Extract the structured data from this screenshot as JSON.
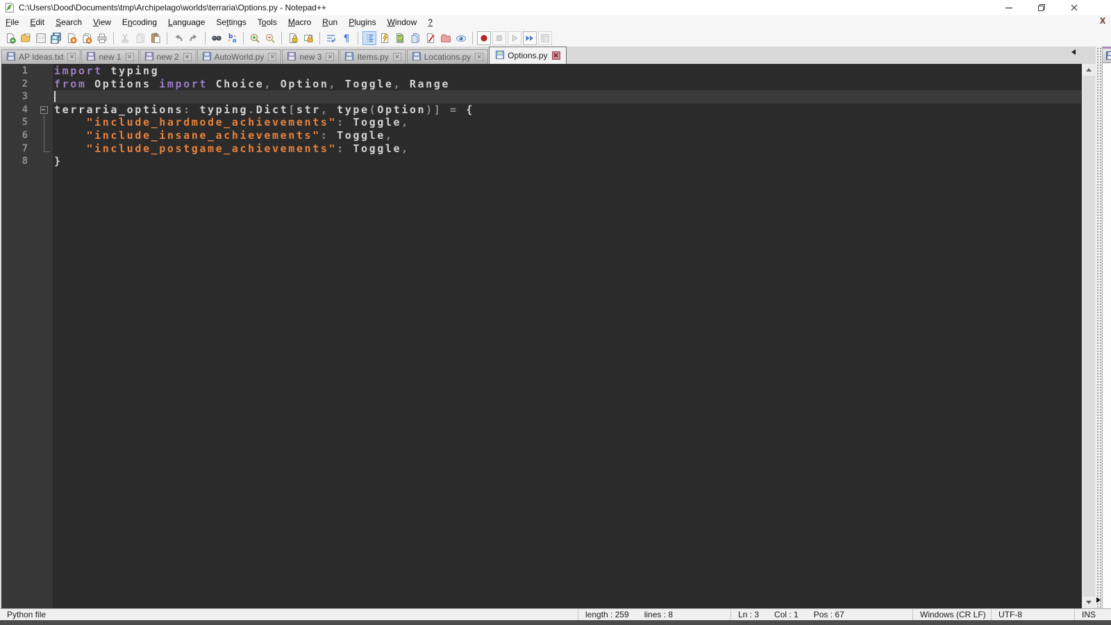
{
  "window": {
    "title": "C:\\Users\\Dood\\Documents\\tmp\\Archipelago\\worlds\\terraria\\Options.py - Notepad++",
    "controls": [
      "minimize",
      "restore",
      "close"
    ]
  },
  "menu": {
    "items": [
      {
        "label": "File",
        "mnemonic": 0
      },
      {
        "label": "Edit",
        "mnemonic": 0
      },
      {
        "label": "Search",
        "mnemonic": 0
      },
      {
        "label": "View",
        "mnemonic": 0
      },
      {
        "label": "Encoding",
        "mnemonic": 1
      },
      {
        "label": "Language",
        "mnemonic": 0
      },
      {
        "label": "Settings",
        "mnemonic": 2
      },
      {
        "label": "Tools",
        "mnemonic": 1
      },
      {
        "label": "Macro",
        "mnemonic": 0
      },
      {
        "label": "Run",
        "mnemonic": 0
      },
      {
        "label": "Plugins",
        "mnemonic": 0
      },
      {
        "label": "Window",
        "mnemonic": 0
      },
      {
        "label": "?",
        "mnemonic": 0
      }
    ],
    "doc_close_glyph": "X"
  },
  "toolbar": {
    "groups": [
      [
        {
          "name": "new-file"
        },
        {
          "name": "open-folder"
        },
        {
          "name": "save",
          "disabled": true
        },
        {
          "name": "save-all"
        },
        {
          "name": "close-doc"
        },
        {
          "name": "close-all-docs"
        },
        {
          "name": "print"
        }
      ],
      [
        {
          "name": "cut",
          "disabled": true
        },
        {
          "name": "copy",
          "disabled": true
        },
        {
          "name": "paste"
        }
      ],
      [
        {
          "name": "undo"
        },
        {
          "name": "redo"
        }
      ],
      [
        {
          "name": "find"
        },
        {
          "name": "replace"
        }
      ],
      [
        {
          "name": "zoom-in"
        },
        {
          "name": "zoom-out"
        }
      ],
      [
        {
          "name": "sync-scroll-v"
        },
        {
          "name": "sync-scroll-h"
        }
      ],
      [
        {
          "name": "word-wrap"
        },
        {
          "name": "show-all-chars"
        }
      ],
      [
        {
          "name": "indent-guide",
          "active": true
        },
        {
          "name": "define-language"
        },
        {
          "name": "document-map"
        },
        {
          "name": "document-list"
        },
        {
          "name": "function-list"
        },
        {
          "name": "folder-as-workspace"
        },
        {
          "name": "monitoring"
        }
      ],
      [
        {
          "name": "macro-record",
          "framed": true
        },
        {
          "name": "macro-stop",
          "framed": true,
          "disabled": true
        },
        {
          "name": "macro-play",
          "framed": true,
          "disabled": true
        },
        {
          "name": "macro-run-multi",
          "framed": true
        },
        {
          "name": "macro-save",
          "framed": true,
          "disabled": true
        }
      ]
    ]
  },
  "tabs": [
    {
      "label": "AP Ideas.txt",
      "icon": "saved",
      "active": false
    },
    {
      "label": "new 1",
      "icon": "new",
      "active": false
    },
    {
      "label": "new 2",
      "icon": "new",
      "active": false
    },
    {
      "label": "AutoWorld.py",
      "icon": "saved",
      "active": false
    },
    {
      "label": "new 3",
      "icon": "new",
      "active": false
    },
    {
      "label": "Items.py",
      "icon": "saved",
      "active": false
    },
    {
      "label": "Locations.py",
      "icon": "saved",
      "active": false
    },
    {
      "label": "Options.py",
      "icon": "saved-active",
      "active": true
    }
  ],
  "editor": {
    "colors": {
      "background": "#2b2b2b",
      "margin_background": "#373737",
      "current_line": "#3a3a3a",
      "text": "#d4d4d4",
      "keyword": "#9d7bc7",
      "string": "#e8823d",
      "operator": "#8f8f8f",
      "line_number": "#8f8f8f"
    },
    "lines": [
      {
        "n": 1,
        "fold": null,
        "current": false,
        "tokens": [
          {
            "t": "import",
            "c": "kw"
          },
          {
            "t": " typing",
            "c": "txt"
          }
        ]
      },
      {
        "n": 2,
        "fold": null,
        "current": false,
        "tokens": [
          {
            "t": "from",
            "c": "kw"
          },
          {
            "t": " Options ",
            "c": "txt"
          },
          {
            "t": "import",
            "c": "kw"
          },
          {
            "t": " Choice",
            "c": "txt"
          },
          {
            "t": ",",
            "c": "op"
          },
          {
            "t": " Option",
            "c": "txt"
          },
          {
            "t": ",",
            "c": "op"
          },
          {
            "t": " Toggle",
            "c": "txt"
          },
          {
            "t": ",",
            "c": "op"
          },
          {
            "t": " Range",
            "c": "txt"
          }
        ]
      },
      {
        "n": 3,
        "fold": null,
        "current": true,
        "tokens": []
      },
      {
        "n": 4,
        "fold": "open",
        "current": false,
        "tokens": [
          {
            "t": "terraria_options",
            "c": "txt"
          },
          {
            "t": ":",
            "c": "op"
          },
          {
            "t": " typing",
            "c": "txt"
          },
          {
            "t": ".",
            "c": "op"
          },
          {
            "t": "Dict",
            "c": "txt"
          },
          {
            "t": "[",
            "c": "op"
          },
          {
            "t": "str",
            "c": "txt"
          },
          {
            "t": ",",
            "c": "op"
          },
          {
            "t": " type",
            "c": "txt"
          },
          {
            "t": "(",
            "c": "op"
          },
          {
            "t": "Option",
            "c": "txt"
          },
          {
            "t": ")]",
            "c": "op"
          },
          {
            "t": " ",
            "c": "txt"
          },
          {
            "t": "=",
            "c": "op"
          },
          {
            "t": " {",
            "c": "txt"
          }
        ]
      },
      {
        "n": 5,
        "fold": "line",
        "current": false,
        "tokens": [
          {
            "t": "    ",
            "c": "txt"
          },
          {
            "t": "\"include_hardmode_achievements\"",
            "c": "str"
          },
          {
            "t": ":",
            "c": "op"
          },
          {
            "t": " Toggle",
            "c": "txt"
          },
          {
            "t": ",",
            "c": "op"
          }
        ]
      },
      {
        "n": 6,
        "fold": "line",
        "current": false,
        "tokens": [
          {
            "t": "    ",
            "c": "txt"
          },
          {
            "t": "\"include_insane_achievements\"",
            "c": "str"
          },
          {
            "t": ":",
            "c": "op"
          },
          {
            "t": " Toggle",
            "c": "txt"
          },
          {
            "t": ",",
            "c": "op"
          }
        ]
      },
      {
        "n": 7,
        "fold": "end",
        "current": false,
        "tokens": [
          {
            "t": "    ",
            "c": "txt"
          },
          {
            "t": "\"include_postgame_achievements\"",
            "c": "str"
          },
          {
            "t": ":",
            "c": "op"
          },
          {
            "t": " Toggle",
            "c": "txt"
          },
          {
            "t": ",",
            "c": "op"
          }
        ]
      },
      {
        "n": 8,
        "fold": null,
        "current": false,
        "tokens": [
          {
            "t": "}",
            "c": "txt"
          }
        ]
      }
    ]
  },
  "statusbar": {
    "file_type": "Python file",
    "length_text": "length : 259",
    "lines_text": "lines : 8",
    "line_text": "Ln : 3",
    "col_text": "Col : 1",
    "pos_text": "Pos : 67",
    "eol": "Windows (CR LF)",
    "encoding": "UTF-8",
    "typing_mode": "INS"
  }
}
